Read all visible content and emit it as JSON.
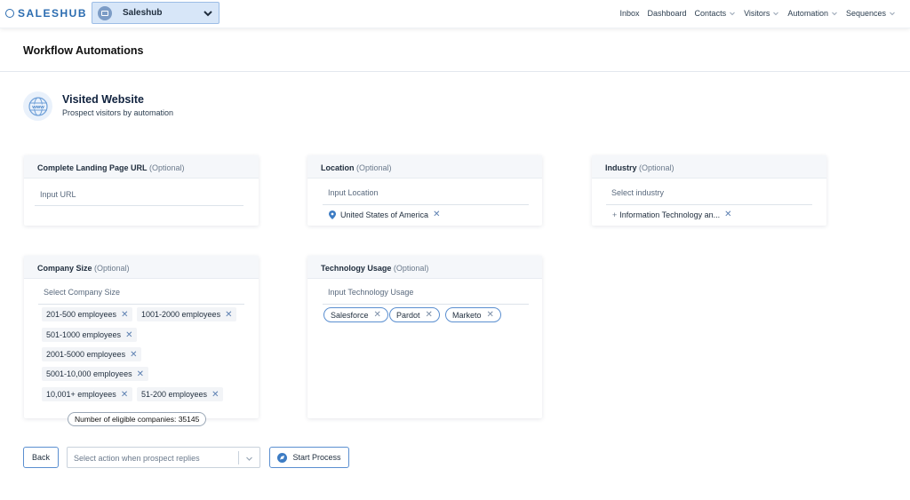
{
  "app": {
    "logo_text": "SALESHUB",
    "workspace": "Saleshub"
  },
  "nav": {
    "items": [
      {
        "label": "Inbox",
        "dropdown": false
      },
      {
        "label": "Dashboard",
        "dropdown": false
      },
      {
        "label": "Contacts",
        "dropdown": true
      },
      {
        "label": "Visitors",
        "dropdown": true
      },
      {
        "label": "Automation",
        "dropdown": true
      },
      {
        "label": "Sequences",
        "dropdown": true
      }
    ]
  },
  "page": {
    "title": "Workflow Automations"
  },
  "hero": {
    "icon": "www-globe-icon",
    "title": "Visited Website",
    "subtitle": "Prospect visitors by automation"
  },
  "cards": {
    "landing": {
      "label": "Complete Landing Page URL",
      "optional": "(Optional)",
      "placeholder": "Input URL"
    },
    "location": {
      "label": "Location",
      "optional": "(Optional)",
      "placeholder": "Input Location",
      "tags": [
        "United States of America"
      ]
    },
    "industry": {
      "label": "Industry",
      "optional": "(Optional)",
      "placeholder": "Select industry",
      "tags": [
        "Information Technology an..."
      ]
    },
    "company_size": {
      "label": "Company Size",
      "optional": "(Optional)",
      "placeholder": "Select Company Size",
      "tags": [
        "201-500 employees",
        "1001-2000 employees",
        "501-1000 employees",
        "2001-5000 employees",
        "5001-10,000 employees",
        "10,001+ employees",
        "51-200 employees"
      ]
    },
    "technology": {
      "label": "Technology Usage",
      "optional": "(Optional)",
      "placeholder": "Input Technology Usage",
      "tags": [
        "Salesforce",
        "Pardot",
        "Marketo"
      ]
    }
  },
  "eligible": "Number of eligible companies: 35145",
  "footer": {
    "back": "Back",
    "action_placeholder": "Select action when prospect replies",
    "start": "Start Process"
  },
  "colors": {
    "accent": "#2b6cb0",
    "border_blue": "#5b8fd0",
    "workspace_bg": "#d7e6f8"
  }
}
